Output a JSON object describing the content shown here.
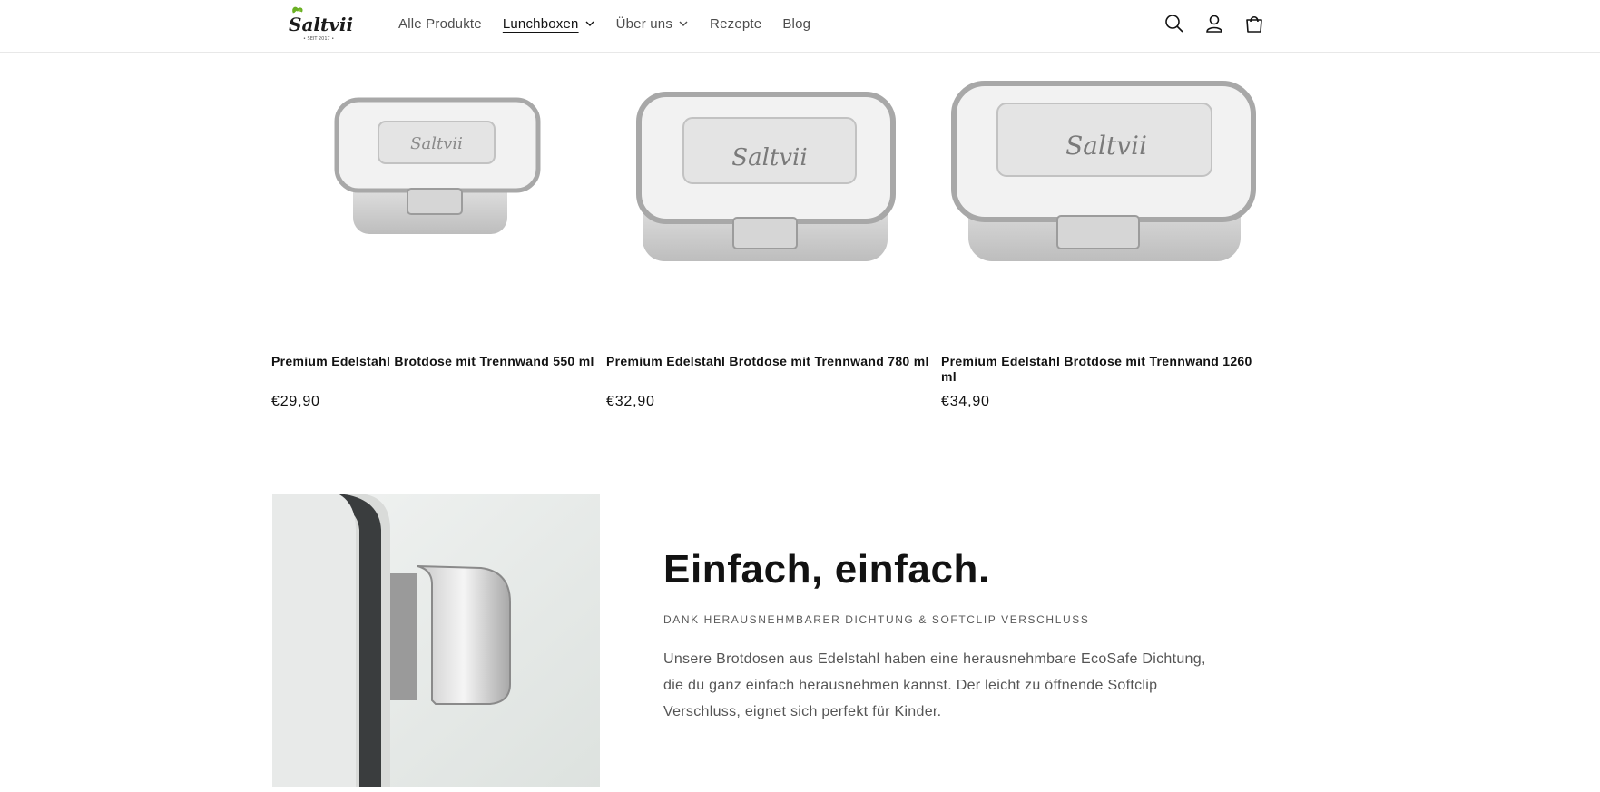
{
  "brand": {
    "logo_text": "Saltvii",
    "logo_tagline": "• SEIT 2017 •",
    "accent": "#6ab023"
  },
  "nav": {
    "items": [
      {
        "label": "Alle Produkte",
        "dropdown": false,
        "active": false
      },
      {
        "label": "Lunchboxen",
        "dropdown": true,
        "active": true
      },
      {
        "label": "Über uns",
        "dropdown": true,
        "active": false
      },
      {
        "label": "Rezepte",
        "dropdown": false,
        "active": false
      },
      {
        "label": "Blog",
        "dropdown": false,
        "active": false
      }
    ]
  },
  "header_icons": [
    "search-icon",
    "account-icon",
    "cart-icon"
  ],
  "products": [
    {
      "title": "Premium Edelstahl Brotdose mit Trennwand 550 ml",
      "price": "€29,90",
      "image_text": "Saltvii"
    },
    {
      "title": "Premium Edelstahl Brotdose mit Trennwand 780 ml",
      "price": "€32,90",
      "image_text": "Saltvii"
    },
    {
      "title": "Premium Edelstahl Brotdose mit Trennwand 1260 ml",
      "price": "€34,90",
      "image_text": "Saltvii"
    }
  ],
  "feature": {
    "title": "Einfach, einfach.",
    "subtitle": "DANK HERAUSNEHMBARER DICHTUNG & SOFTCLIP VERSCHLUSS",
    "text": "Unsere Brotdosen aus Edelstahl haben eine herausnehmbare EcoSafe Dichtung, die du ganz einfach herausnehmen kannst. Der leicht zu öffnende Softclip Verschluss, eignet sich perfekt für Kinder."
  }
}
